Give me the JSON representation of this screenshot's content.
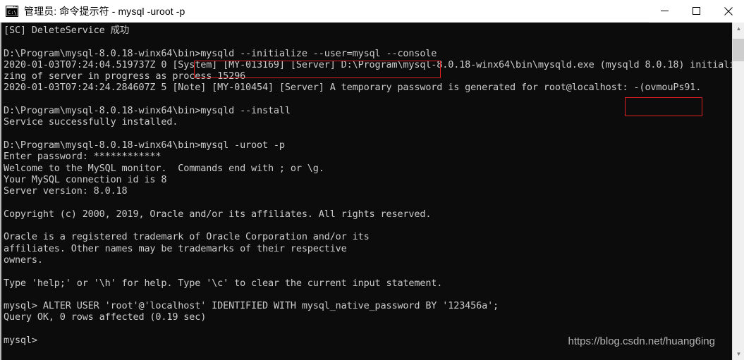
{
  "window": {
    "title": "管理员: 命令提示符 - mysql  -uroot -p",
    "icon": "cmd-console-icon",
    "controls": {
      "minimize": "minimize-button",
      "maximize": "maximize-button",
      "close": "close-button"
    }
  },
  "console": {
    "background": "#0c0c0c",
    "foreground": "#cccccc",
    "lines": [
      "[SC] DeleteService 成功",
      "",
      "D:\\Program\\mysql-8.0.18-winx64\\bin>mysqld --initialize --user=mysql --console",
      "2020-01-03T07:24:04.519737Z 0 [System] [MY-013169] [Server] D:\\Program\\mysql-8.0.18-winx64\\bin\\mysqld.exe (mysqld 8.0.18) initiali",
      "zing of server in progress as process 15296",
      "2020-01-03T07:24:24.284607Z 5 [Note] [MY-010454] [Server] A temporary password is generated for root@localhost: -(ovmouPs91.",
      "",
      "D:\\Program\\mysql-8.0.18-winx64\\bin>mysqld --install",
      "Service successfully installed.",
      "",
      "D:\\Program\\mysql-8.0.18-winx64\\bin>mysql -uroot -p",
      "Enter password: ************",
      "Welcome to the MySQL monitor.  Commands end with ; or \\g.",
      "Your MySQL connection id is 8",
      "Server version: 8.0.18",
      "",
      "Copyright (c) 2000, 2019, Oracle and/or its affiliates. All rights reserved.",
      "",
      "Oracle is a registered trademark of Oracle Corporation and/or its",
      "affiliates. Other names may be trademarks of their respective",
      "owners.",
      "",
      "Type 'help;' or '\\h' for help. Type '\\c' to clear the current input statement.",
      "",
      "mysql> ALTER USER 'root'@'localhost' IDENTIFIED WITH mysql_native_password BY '123456a';",
      "Query OK, 0 rows affected (0.19 sec)",
      "",
      "mysql>"
    ]
  },
  "highlights": {
    "color": "#e02020",
    "command_box_text": "mysqld --initialize --user=mysql --console",
    "password_box_text": "-(ovmouPs91."
  },
  "watermark": {
    "text": "https://blog.csdn.net/huang6ing"
  },
  "scrollbar": {
    "up_arrow": "▲",
    "down_arrow": "▼"
  }
}
